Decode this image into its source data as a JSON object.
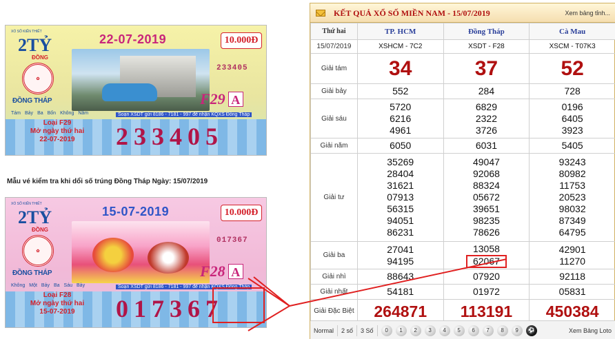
{
  "ticket1": {
    "brand_small": "XỔ SỐ KIẾN THIẾT",
    "brand_big": "2TỶ",
    "brand_sub": "ĐỒNG",
    "province": "ĐỒNG THÁP",
    "date": "22-07-2019",
    "price": "10.000Đ",
    "serial_small": "233405",
    "code": "F29",
    "code_letter": "A",
    "denoms": [
      "Tám",
      "Bảy",
      "Ba",
      "Bốn",
      "Không",
      "Năm"
    ],
    "contact": "Soạn XSDT gửi 8186 - 7181 - 997 để nhận KQXS Đồng Tháp",
    "loai": "Loại F29",
    "mo_ngay": "Mở ngày thứ hai",
    "open_date": "22-07-2019",
    "number": "233405"
  },
  "caption": "Mẫu vé kiểm tra khi dổi số trúng Đồng Tháp Ngày: 15/07/2019",
  "ticket2": {
    "brand_small": "XỔ SỐ KIẾN THIẾT",
    "brand_big": "2TỶ",
    "brand_sub": "ĐỒNG",
    "province": "ĐỒNG THÁP",
    "date": "15-07-2019",
    "price": "10.000Đ",
    "serial_small": "017367",
    "code": "F28",
    "code_letter": "A",
    "denoms": [
      "Không",
      "Một",
      "Bảy",
      "Ba",
      "Sáu",
      "Bảy"
    ],
    "contact": "Soạn XSDT gửi 8186 - 7181 - 997 để nhận KQXS Đồng Tháp",
    "loai": "Loại F28",
    "mo_ngay": "Mở ngày thứ hai",
    "open_date": "15-07-2019",
    "number": "017367"
  },
  "panel": {
    "title": "KẾT QUẢ XỔ SỐ MIỀN NAM - 15/07/2019",
    "link": "Xem bảng tỉnh...",
    "day": "Thứ hai",
    "date": "15/07/2019",
    "provinces": [
      "TP. HCM",
      "Đồng Tháp",
      "Cà Mau"
    ],
    "codes": [
      "XSHCM - 7C2",
      "XSDT - F28",
      "XSCM - T07K3"
    ],
    "labels": {
      "g8": "Giải tám",
      "g7": "Giải bảy",
      "g6": "Giải sáu",
      "g5": "Giải năm",
      "g4": "Giải tư",
      "g3": "Giải ba",
      "g2": "Giải nhì",
      "g1": "Giải nhất",
      "gdb": "Giải Đặc Biệt"
    },
    "g8": [
      "34",
      "37",
      "52"
    ],
    "g7": [
      "552",
      "284",
      "728"
    ],
    "g6": [
      [
        "5720",
        "6216",
        "4961"
      ],
      [
        "6829",
        "2322",
        "3726"
      ],
      [
        "0196",
        "6405",
        "3923"
      ]
    ],
    "g5": [
      "6050",
      "6031",
      "5405"
    ],
    "g4": [
      [
        "35269",
        "28404",
        "31621",
        "07913",
        "56315",
        "94051",
        "86231"
      ],
      [
        "49047",
        "92068",
        "88324",
        "05672",
        "39651",
        "98235",
        "78626"
      ],
      [
        "93243",
        "80982",
        "11753",
        "20523",
        "98032",
        "87349",
        "64795"
      ]
    ],
    "g3": [
      [
        "27041",
        "94195"
      ],
      [
        "13058",
        "62067"
      ],
      [
        "42901",
        "11270"
      ]
    ],
    "g2": [
      "88643",
      "07920",
      "92118"
    ],
    "g1": [
      "54181",
      "01972",
      "05831"
    ],
    "gdb": [
      "264871",
      "113191",
      "450384"
    ],
    "footer": {
      "tabs": [
        "Normal",
        "2 số",
        "3 Số"
      ],
      "digits": [
        "0",
        "1",
        "2",
        "3",
        "4",
        "5",
        "6",
        "7",
        "8",
        "9"
      ],
      "link": "Xem Bảng Loto"
    }
  },
  "colors": {
    "accent_red": "#b01010",
    "highlight": "#e02020",
    "header_blue": "#2a3f9a"
  }
}
